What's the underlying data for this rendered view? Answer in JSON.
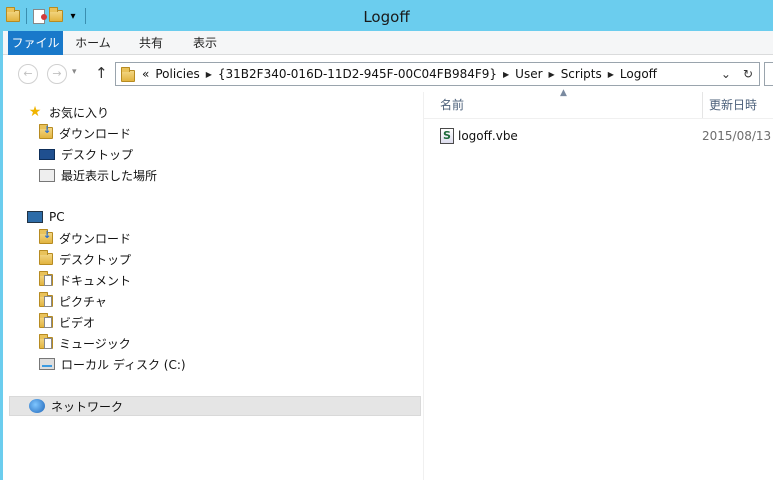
{
  "window": {
    "title": "Logoff"
  },
  "ribbon": {
    "tabs": [
      {
        "label": "ファイル"
      },
      {
        "label": "ホーム"
      },
      {
        "label": "共有"
      },
      {
        "label": "表示"
      }
    ]
  },
  "address": {
    "crumbs": [
      "Policies",
      "{31B2F340-016D-11D2-945F-00C04FB984F9}",
      "User",
      "Scripts",
      "Logoff"
    ],
    "overflow": "«"
  },
  "nav": {
    "favorites": {
      "label": "お気に入り",
      "items": [
        {
          "label": "ダウンロード",
          "icon": "download-folder-icon"
        },
        {
          "label": "デスクトップ",
          "icon": "desktop-icon"
        },
        {
          "label": "最近表示した場所",
          "icon": "recent-places-icon"
        }
      ]
    },
    "pc": {
      "label": "PC",
      "items": [
        {
          "label": "ダウンロード",
          "icon": "download-folder-icon"
        },
        {
          "label": "デスクトップ",
          "icon": "desktop-folder-icon"
        },
        {
          "label": "ドキュメント",
          "icon": "documents-folder-icon"
        },
        {
          "label": "ピクチャ",
          "icon": "pictures-folder-icon"
        },
        {
          "label": "ビデオ",
          "icon": "videos-folder-icon"
        },
        {
          "label": "ミュージック",
          "icon": "music-folder-icon"
        },
        {
          "label": "ローカル ディスク (C:)",
          "icon": "local-disk-icon"
        }
      ]
    },
    "network": {
      "label": "ネットワーク"
    }
  },
  "content": {
    "columns": {
      "name": "名前",
      "date": "更新日時"
    },
    "files": [
      {
        "name": "logoff.vbe",
        "date": "2015/08/13",
        "icon": "vbscript-file-icon"
      }
    ]
  },
  "colors": {
    "titlebar": "#6bcdee",
    "file_tab": "#1979ca",
    "selected_row": "#e5e5e5"
  }
}
